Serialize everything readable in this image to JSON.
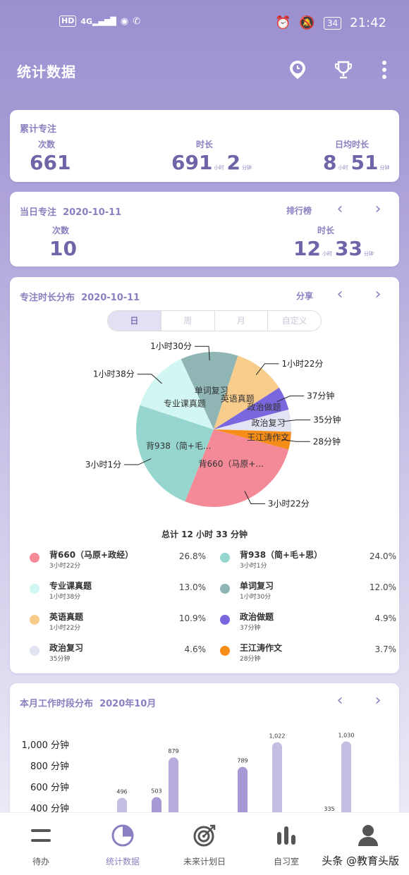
{
  "status_bar": {
    "hd": "HD",
    "signal": "4G",
    "battery": "34",
    "time": "21:42"
  },
  "app_bar": {
    "title": "统计数据",
    "actions": [
      "clock-icon",
      "trophy-icon",
      "more-icon"
    ]
  },
  "cumulative": {
    "title": "累计专注",
    "count_label": "次数",
    "count": "661",
    "duration_label": "时长",
    "duration_hours": "691",
    "duration_minutes": "2",
    "daily_avg_label": "日均时长",
    "daily_hours": "8",
    "daily_minutes": "51",
    "unit_hour": "小时",
    "unit_minute": "分钟"
  },
  "daily": {
    "title": "当日专注",
    "date": "2020-10-11",
    "ranking": "排行榜",
    "count_label": "次数",
    "count": "10",
    "duration_label": "时长",
    "hours": "12",
    "minutes": "33",
    "unit_hour": "小时",
    "unit_minute": "分钟"
  },
  "distribution": {
    "title": "专注时长分布",
    "date": "2020-10-11",
    "share": "分享",
    "tabs": [
      "日",
      "周",
      "月",
      "自定义"
    ],
    "active_tab": "日",
    "total": "总计 12 小时 33 分钟",
    "colors": {
      "p660": "#f48a98",
      "p938": "#97d6cf",
      "zyk": "#d2f6f2",
      "dc": "#8fb6b4",
      "yy": "#f8cd8c",
      "zz": "#7a67dd",
      "zf": "#e3e4f3",
      "wj": "#f78d19"
    },
    "legend": [
      {
        "name": "背660（马原+政经）",
        "dur": "3小时22分",
        "pct": "26.8%",
        "color": "#f48a98"
      },
      {
        "name": "背938（简+毛+思）",
        "dur": "3小时1分",
        "pct": "24.0%",
        "color": "#97d6cf"
      },
      {
        "name": "专业课真题",
        "dur": "1小时38分",
        "pct": "13.0%",
        "color": "#d2f6f2"
      },
      {
        "name": "单词复习",
        "dur": "1小时30分",
        "pct": "12.0%",
        "color": "#8fb6b4"
      },
      {
        "name": "英语真题",
        "dur": "1小时22分",
        "pct": "10.9%",
        "color": "#f8cd8c"
      },
      {
        "name": "政治做题",
        "dur": "37分钟",
        "pct": "4.9%",
        "color": "#7a67dd"
      },
      {
        "name": "政治复习",
        "dur": "35分钟",
        "pct": "4.6%",
        "color": "#e3e4f3"
      },
      {
        "name": "王江涛作文",
        "dur": "28分钟",
        "pct": "3.7%",
        "color": "#f78d19"
      }
    ],
    "pie_labels": {
      "dc_in": "单词复习",
      "yy_in": "英语真题",
      "zz_in": "政治做题",
      "zf_in": "政治复习",
      "wj_in": "王江涛作文",
      "zyk_in": "专业课真题",
      "p938_in": "背938（简+毛...",
      "p660_in": "背660（马原+...",
      "dc_out": "1小时30分",
      "yy_out": "1小时22分",
      "zz_out": "37分钟",
      "zf_out": "35分钟",
      "wj_out": "28分钟",
      "zyk_out": "1小时38分",
      "p938_out": "3小时1分",
      "p660_out": "3小时22分"
    }
  },
  "chart_data": {
    "type": "bar",
    "title": "本月工作时段分布 2020年10月",
    "pie": {
      "type": "pie",
      "slices": [
        {
          "label": "背660（马原+政经）",
          "value": 26.8,
          "display": "3小时22分"
        },
        {
          "label": "背938（简+毛+思）",
          "value": 24.0,
          "display": "3小时1分"
        },
        {
          "label": "专业课真题",
          "value": 13.0,
          "display": "1小时38分"
        },
        {
          "label": "单词复习",
          "value": 12.0,
          "display": "1小时30分"
        },
        {
          "label": "英语真题",
          "value": 10.9,
          "display": "1小时22分"
        },
        {
          "label": "政治做题",
          "value": 4.9,
          "display": "37分钟"
        },
        {
          "label": "政治复习",
          "value": 4.6,
          "display": "35分钟"
        },
        {
          "label": "王江涛作文",
          "value": 3.7,
          "display": "28分钟"
        }
      ]
    },
    "y_ticks": [
      "1,000 分钟",
      "800 分钟",
      "600 分钟",
      "400 分钟"
    ],
    "ylim": [
      400,
      1000
    ],
    "bars": [
      {
        "value": 496,
        "label": "496"
      },
      {
        "value": 503,
        "label": "503"
      },
      {
        "value": 879,
        "label": "879"
      },
      {
        "value": 789,
        "label": "789"
      },
      {
        "value": 1022,
        "label": "1,022"
      },
      {
        "value": 335,
        "label": "335"
      },
      {
        "value": 1030,
        "label": "1,030"
      }
    ]
  },
  "monthly": {
    "title": "本月工作时段分布",
    "month": "2020年10月"
  },
  "bottom_nav": [
    {
      "label": "待办",
      "icon": "menu-icon"
    },
    {
      "label": "统计数据",
      "icon": "pie-chart-icon"
    },
    {
      "label": "未来计划日",
      "icon": "target-icon"
    },
    {
      "label": "自习室",
      "icon": "bar-chart-icon"
    },
    {
      "label": "",
      "icon": "person-icon"
    }
  ],
  "watermark": "头条 @教育头版"
}
